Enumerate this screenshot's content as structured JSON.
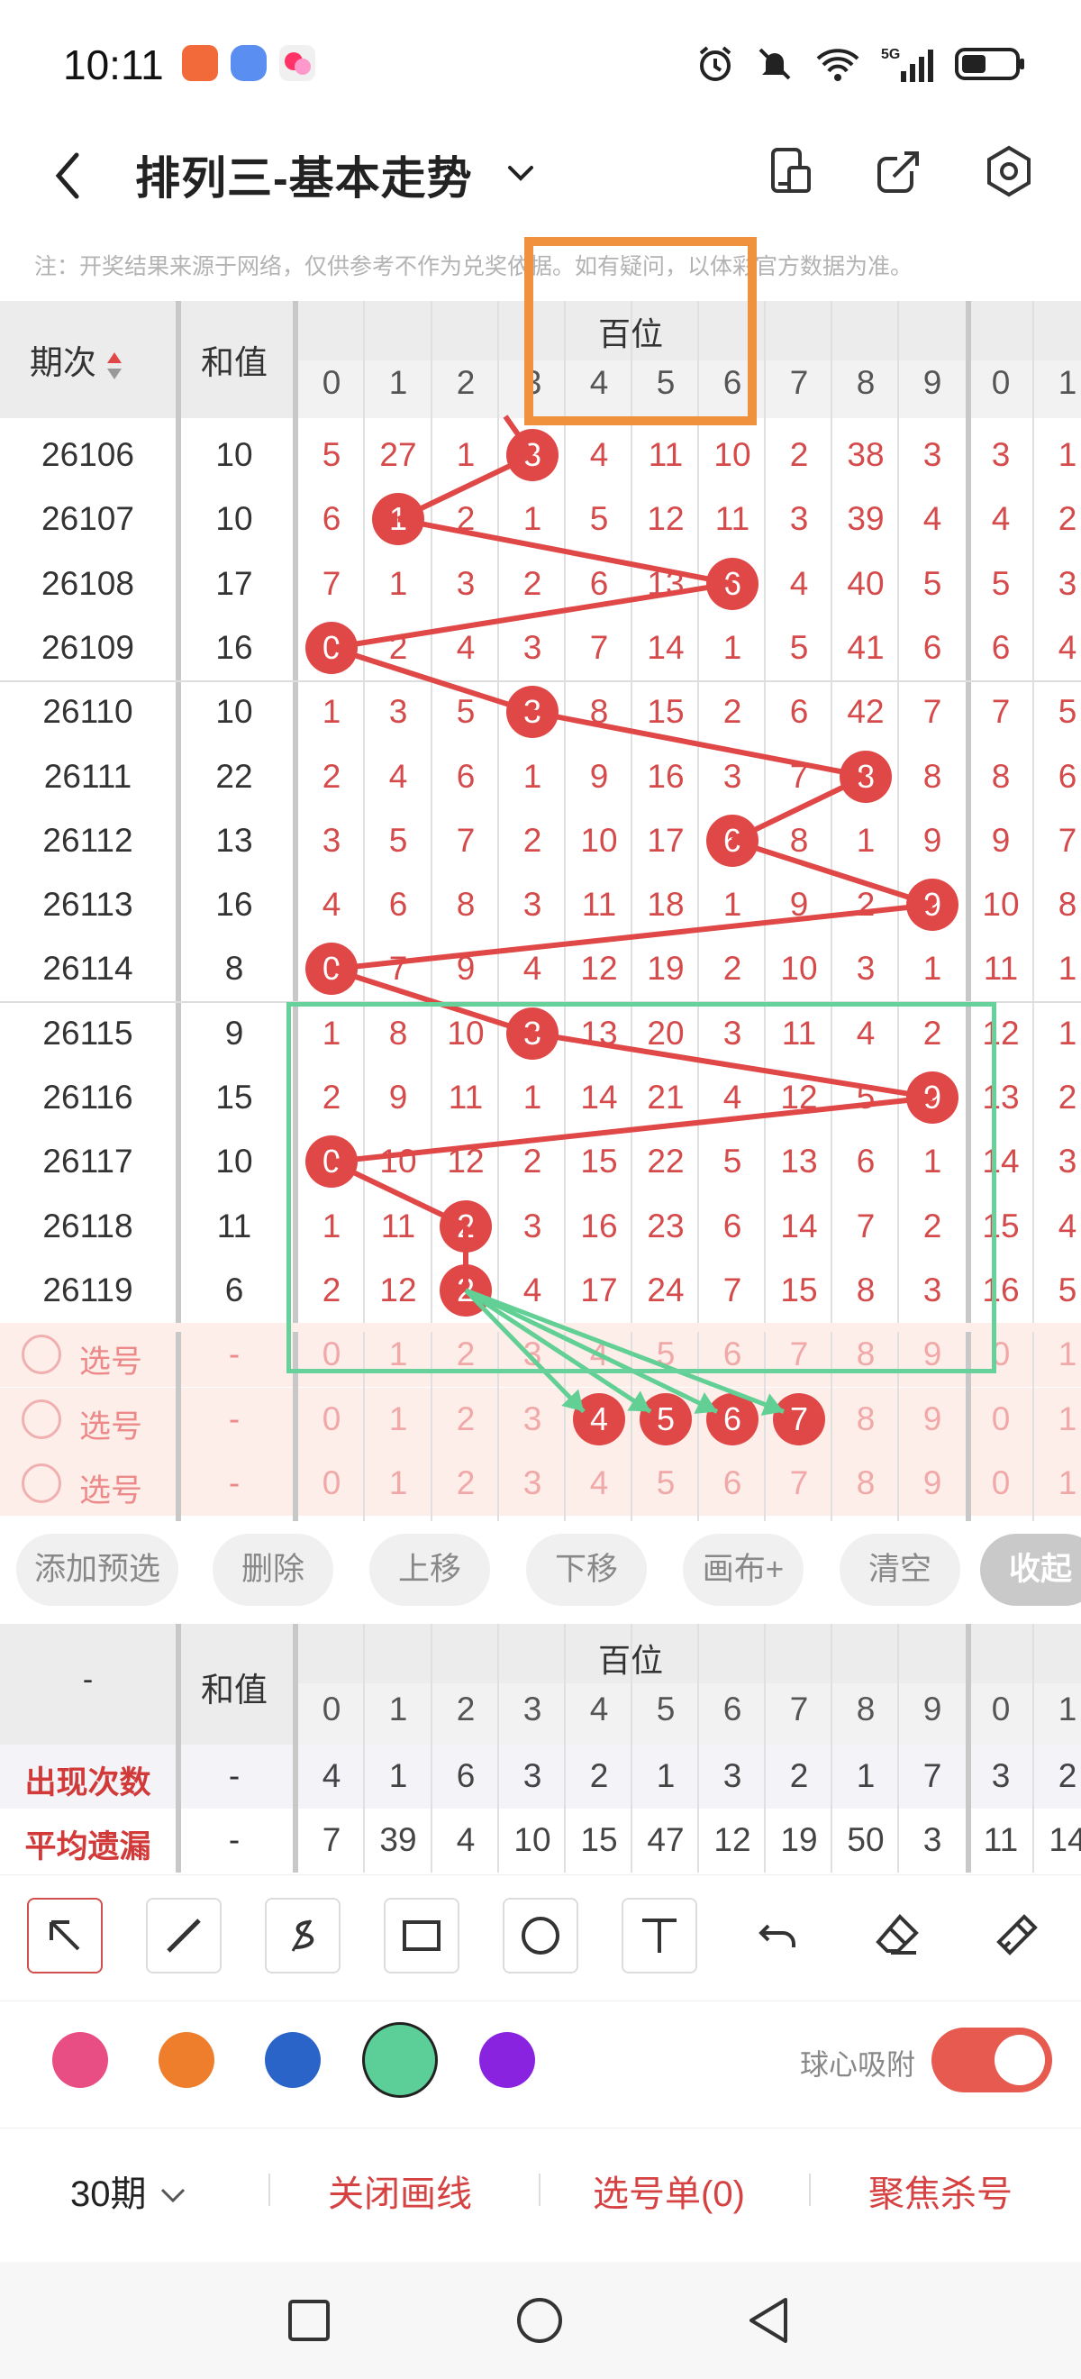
{
  "status": {
    "time": "10:11",
    "net_5g": "5G",
    "net_6": "6",
    "battery": "40"
  },
  "title": "排列三-基本走势",
  "note": "注：开奖结果来源于网络，仅供参考不作为兑奖依据。如有疑问，以体彩官方数据为准。",
  "header": {
    "period": "期次",
    "sum": "和值",
    "group": "百位",
    "digits": [
      "0",
      "1",
      "2",
      "3",
      "4",
      "5",
      "6",
      "7",
      "8",
      "9",
      "0",
      "1"
    ]
  },
  "rows": [
    {
      "period": "26106",
      "sum": "10",
      "cells": [
        "5",
        "27",
        "1",
        "3",
        "4",
        "11",
        "10",
        "2",
        "38",
        "3",
        "3",
        "1"
      ],
      "ball": 3
    },
    {
      "period": "26107",
      "sum": "10",
      "cells": [
        "6",
        "1",
        "2",
        "1",
        "5",
        "12",
        "11",
        "3",
        "39",
        "4",
        "4",
        "2"
      ],
      "ball": 1
    },
    {
      "period": "26108",
      "sum": "17",
      "cells": [
        "7",
        "1",
        "3",
        "2",
        "6",
        "13",
        "6",
        "4",
        "40",
        "5",
        "5",
        "3"
      ],
      "ball": 6
    },
    {
      "period": "26109",
      "sum": "16",
      "cells": [
        "0",
        "2",
        "4",
        "3",
        "7",
        "14",
        "1",
        "5",
        "41",
        "6",
        "6",
        "4"
      ],
      "ball": 0
    },
    {
      "period": "26110",
      "sum": "10",
      "cells": [
        "1",
        "3",
        "5",
        "3",
        "8",
        "15",
        "2",
        "6",
        "42",
        "7",
        "7",
        "5"
      ],
      "ball": 3
    },
    {
      "period": "26111",
      "sum": "22",
      "cells": [
        "2",
        "4",
        "6",
        "1",
        "9",
        "16",
        "3",
        "7",
        "8",
        "8",
        "8",
        "6"
      ],
      "ball": 8
    },
    {
      "period": "26112",
      "sum": "13",
      "cells": [
        "3",
        "5",
        "7",
        "2",
        "10",
        "17",
        "6",
        "8",
        "1",
        "9",
        "9",
        "7"
      ],
      "ball": 6
    },
    {
      "period": "26113",
      "sum": "16",
      "cells": [
        "4",
        "6",
        "8",
        "3",
        "11",
        "18",
        "1",
        "9",
        "2",
        "9",
        "10",
        "8"
      ],
      "ball": 9
    },
    {
      "period": "26114",
      "sum": "8",
      "cells": [
        "0",
        "7",
        "9",
        "4",
        "12",
        "19",
        "2",
        "10",
        "3",
        "1",
        "11",
        "1"
      ],
      "ball": 0
    },
    {
      "period": "26115",
      "sum": "9",
      "cells": [
        "1",
        "8",
        "10",
        "3",
        "13",
        "20",
        "3",
        "11",
        "4",
        "2",
        "12",
        "1"
      ],
      "ball": 3
    },
    {
      "period": "26116",
      "sum": "15",
      "cells": [
        "2",
        "9",
        "11",
        "1",
        "14",
        "21",
        "4",
        "12",
        "5",
        "9",
        "13",
        "2"
      ],
      "ball": 9
    },
    {
      "period": "26117",
      "sum": "10",
      "cells": [
        "0",
        "10",
        "12",
        "2",
        "15",
        "22",
        "5",
        "13",
        "6",
        "1",
        "14",
        "3"
      ],
      "ball": 0
    },
    {
      "period": "26118",
      "sum": "11",
      "cells": [
        "1",
        "11",
        "2",
        "3",
        "16",
        "23",
        "6",
        "14",
        "7",
        "2",
        "15",
        "4"
      ],
      "ball": 2
    },
    {
      "period": "26119",
      "sum": "6",
      "cells": [
        "2",
        "12",
        "2",
        "4",
        "17",
        "24",
        "7",
        "15",
        "8",
        "3",
        "16",
        "5"
      ],
      "ball": 2
    }
  ],
  "pick_rows": [
    {
      "label": "选号",
      "sum": "-",
      "cells": [
        "0",
        "1",
        "2",
        "3",
        "4",
        "5",
        "6",
        "7",
        "8",
        "9",
        "0",
        "1"
      ]
    },
    {
      "label": "选号",
      "sum": "-",
      "cells": [
        "0",
        "1",
        "2",
        "3",
        "4",
        "5",
        "6",
        "7",
        "8",
        "9",
        "0",
        "1"
      ]
    },
    {
      "label": "选号",
      "sum": "-",
      "cells": [
        "0",
        "1",
        "2",
        "3",
        "4",
        "5",
        "6",
        "7",
        "8",
        "9",
        "0",
        "1"
      ]
    }
  ],
  "buttons": [
    "添加预选",
    "删除",
    "上移",
    "下移",
    "画布+",
    "清空",
    "收起"
  ],
  "stats": {
    "corner": "-",
    "sum": "和值",
    "group": "百位",
    "digits": [
      "0",
      "1",
      "2",
      "3",
      "4",
      "5",
      "6",
      "7",
      "8",
      "9",
      "0",
      "1"
    ],
    "rows": [
      {
        "label": "出现次数",
        "sum": "-",
        "cells": [
          "4",
          "1",
          "6",
          "3",
          "2",
          "1",
          "3",
          "2",
          "1",
          "7",
          "3",
          "2"
        ]
      },
      {
        "label": "平均遗漏",
        "sum": "-",
        "cells": [
          "7",
          "39",
          "4",
          "10",
          "15",
          "47",
          "12",
          "19",
          "50",
          "3",
          "11",
          "14"
        ]
      }
    ]
  },
  "tools": [
    "arrow-tool",
    "line-tool",
    "freehand-tool",
    "rect-tool",
    "circle-tool",
    "text-tool",
    "undo-tool",
    "eraser-tool",
    "clear-brush-tool"
  ],
  "colors": [
    "#e84d83",
    "#ee7d2c",
    "#2a64c8",
    "#5ccf98",
    "#8a23e0"
  ],
  "snap_label": "球心吸附",
  "bottom": {
    "periods": "30期",
    "close_draw": "关闭画线",
    "pick_list": "选号单(0)",
    "focus_kill": "聚焦杀号"
  }
}
